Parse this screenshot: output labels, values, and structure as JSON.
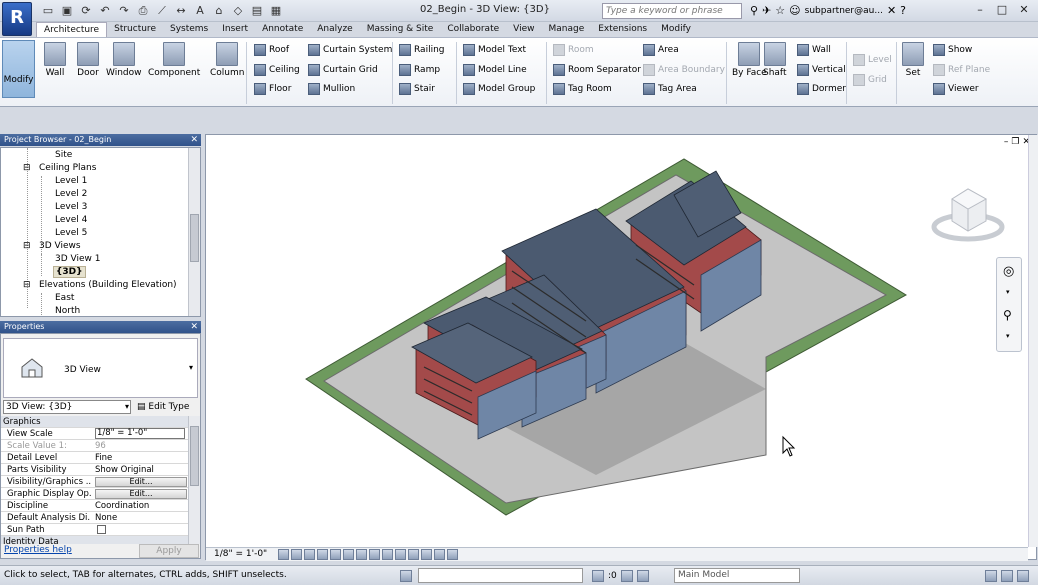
{
  "window": {
    "doc_title": "02_Begin - 3D View: {3D}",
    "search_placeholder": "Type a keyword or phrase",
    "user": "subpartner@au..."
  },
  "tabs": [
    "Architecture",
    "Structure",
    "Systems",
    "Insert",
    "Annotate",
    "Analyze",
    "Massing & Site",
    "Collaborate",
    "View",
    "Manage",
    "Extensions",
    "Modify"
  ],
  "ribbon": {
    "modify": "Modify",
    "wall": "Wall",
    "door": "Door",
    "window": "Window",
    "component": "Component",
    "column": "Column",
    "roof": "Roof",
    "ceiling": "Ceiling",
    "floor": "Floor",
    "curtain_system": "Curtain System",
    "curtain_grid": "Curtain Grid",
    "mullion": "Mullion",
    "railing": "Railing",
    "ramp": "Ramp",
    "stair": "Stair",
    "model_text": "Model Text",
    "model_line": "Model Line",
    "model_group": "Model Group",
    "room": "Room",
    "room_separator": "Room Separator",
    "tag_room": "Tag Room",
    "area": "Area",
    "area_boundary": "Area Boundary",
    "tag_area": "Tag Area",
    "by_face": "By Face",
    "shaft": "Shaft",
    "wall_opening": "Wall",
    "vertical": "Vertical",
    "dormer": "Dormer",
    "level": "Level",
    "grid": "Grid",
    "set": "Set",
    "show": "Show",
    "ref_plane": "Ref Plane",
    "viewer": "Viewer"
  },
  "project_browser": {
    "title": "Project Browser - 02_Begin",
    "items": [
      {
        "label": "Site"
      },
      {
        "label": "Ceiling Plans"
      },
      {
        "label": "Level 1"
      },
      {
        "label": "Level 2"
      },
      {
        "label": "Level 3"
      },
      {
        "label": "Level 4"
      },
      {
        "label": "Level 5"
      },
      {
        "label": "3D Views"
      },
      {
        "label": "3D View 1"
      },
      {
        "label": "{3D}"
      },
      {
        "label": "Elevations (Building Elevation)"
      },
      {
        "label": "East"
      },
      {
        "label": "North"
      }
    ]
  },
  "properties": {
    "title": "Properties",
    "type_name": "3D View",
    "type_select": "3D View: {3D}",
    "edit_type": "Edit Type",
    "rows": [
      {
        "k": "Graphics",
        "v": ""
      },
      {
        "k": "View Scale",
        "v": "1/8\" = 1'-0\""
      },
      {
        "k": "Scale Value    1:",
        "v": "96"
      },
      {
        "k": "Detail Level",
        "v": "Fine"
      },
      {
        "k": "Parts Visibility",
        "v": "Show Original"
      },
      {
        "k": "Visibility/Graphics ...",
        "v": "Edit..."
      },
      {
        "k": "Graphic Display Op...",
        "v": "Edit..."
      },
      {
        "k": "Discipline",
        "v": "Coordination"
      },
      {
        "k": "Default Analysis Di...",
        "v": "None"
      },
      {
        "k": "Sun Path",
        "v": ""
      },
      {
        "k": "Identity Data",
        "v": ""
      }
    ],
    "help": "Properties help",
    "apply": "Apply"
  },
  "view": {
    "scale": "1/8\" = 1'-0\""
  },
  "status": {
    "message": "Click to select, TAB for alternates, CTRL adds, SHIFT unselects.",
    "workset_count": ":0",
    "model": "Main Model"
  },
  "colors": {
    "ribbon_accent": "#3b6fb6",
    "site_green": "#6e9a5e",
    "brick": "#a34a4a",
    "roof": "#4b5a70"
  }
}
